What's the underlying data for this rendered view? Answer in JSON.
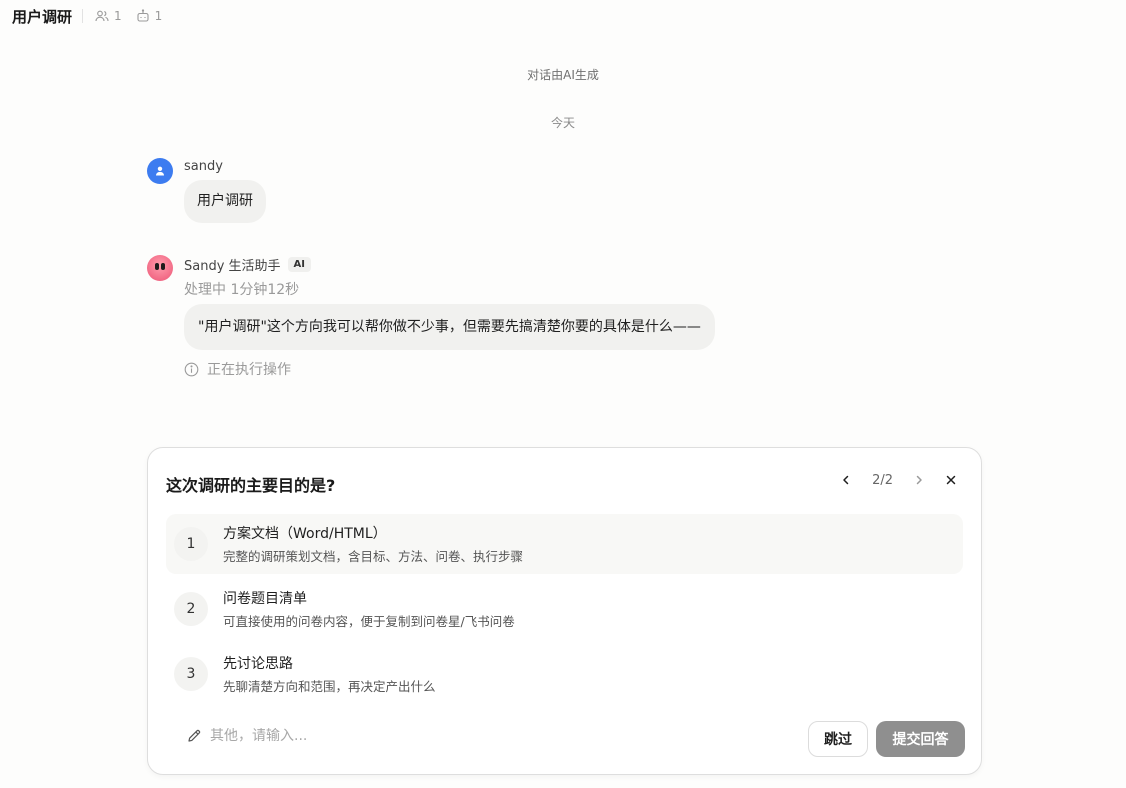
{
  "header": {
    "title": "用户调研",
    "members_count": "1",
    "bots_count": "1"
  },
  "chat": {
    "generated_note": "对话由AI生成",
    "date_separator": "今天",
    "messages": [
      {
        "sender": "sandy",
        "text": "用户调研"
      },
      {
        "sender": "Sandy 生活助手",
        "badge": "AI",
        "status": "处理中 1分钟12秒",
        "text": "\"用户调研\"这个方向我可以帮你做不少事，但需要先搞清楚你要的具体是什么——",
        "action": "正在执行操作"
      }
    ]
  },
  "question_card": {
    "title": "这次调研的主要目的是?",
    "pager": "2/2",
    "options": [
      {
        "num": "1",
        "title": "方案文档（Word/HTML）",
        "desc": "完整的调研策划文档，含目标、方法、问卷、执行步骤"
      },
      {
        "num": "2",
        "title": "问卷题目清单",
        "desc": "可直接使用的问卷内容，便于复制到问卷星/飞书问卷"
      },
      {
        "num": "3",
        "title": "先讨论思路",
        "desc": "先聊清楚方向和范围，再决定产出什么"
      }
    ],
    "other_placeholder": "其他，请输入...",
    "skip_label": "跳过",
    "submit_label": "提交回答"
  },
  "icons": {
    "members": "users-icon",
    "bots": "bot-icon",
    "user_avatar": "user-icon",
    "info": "info-icon",
    "prev": "chevron-left-icon",
    "next": "chevron-right-icon",
    "close": "close-icon",
    "edit": "pencil-icon"
  },
  "colors": {
    "user_avatar": "#3d7cf0",
    "bot_avatar": "#f26a86",
    "submit_disabled": "#8f8f8f"
  }
}
